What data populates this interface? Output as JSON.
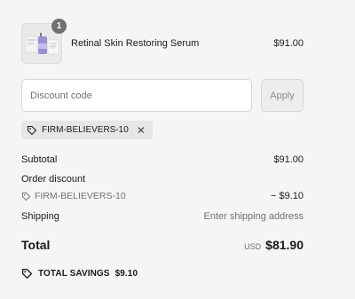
{
  "line_item": {
    "quantity": "1",
    "name": "Retinal Skin Restoring Serum",
    "price": "$91.00"
  },
  "discount": {
    "placeholder": "Discount code",
    "apply_label": "Apply",
    "applied_code": "FIRM-BELIEVERS-10"
  },
  "summary": {
    "subtotal_label": "Subtotal",
    "subtotal_value": "$91.00",
    "order_discount_label": "Order discount",
    "order_discount_code": "FIRM-BELIEVERS-10",
    "order_discount_value": "− $9.10",
    "shipping_label": "Shipping",
    "shipping_value": "Enter shipping address"
  },
  "total": {
    "label": "Total",
    "currency": "USD",
    "value": "$81.90"
  },
  "savings": {
    "label": "TOTAL SAVINGS",
    "value": "$9.10"
  },
  "icons": {
    "tag": "tag-icon",
    "close": "close-icon",
    "savings": "price-tag-icon"
  }
}
